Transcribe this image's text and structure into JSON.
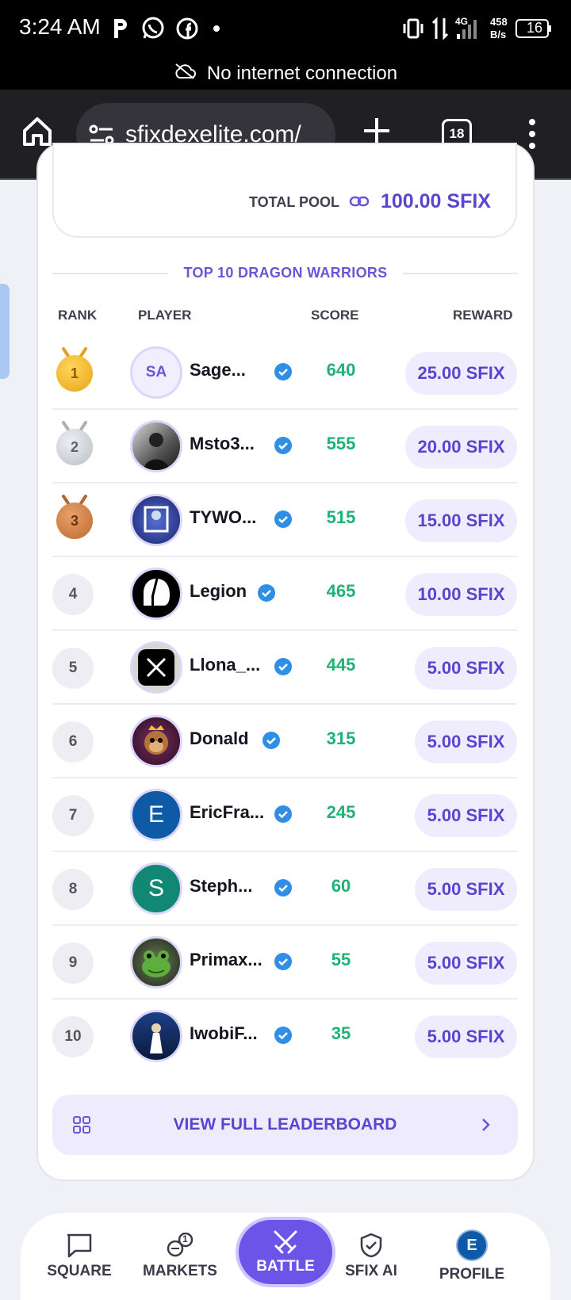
{
  "status_bar": {
    "time": "3:24 AM",
    "network_type": "4G",
    "data_speed_value": "458",
    "data_speed_unit": "B/s",
    "battery": "16",
    "notice": "No internet connection"
  },
  "browser": {
    "url": "sfixdexelite.com/",
    "tab_count": "18"
  },
  "pool": {
    "label": "TOTAL POOL",
    "value": "100.00 SFIX"
  },
  "leaderboard": {
    "title": "TOP 10 DRAGON WARRIORS",
    "headers": {
      "rank": "RANK",
      "player": "PLAYER",
      "score": "SCORE",
      "reward": "REWARD"
    },
    "rows": [
      {
        "rank": "1",
        "name": "Sage...",
        "initials": "SA",
        "score": "640",
        "reward": "25.00 SFIX"
      },
      {
        "rank": "2",
        "name": "Msto3...",
        "score": "555",
        "reward": "20.00 SFIX"
      },
      {
        "rank": "3",
        "name": "TYWO...",
        "score": "515",
        "reward": "15.00 SFIX"
      },
      {
        "rank": "4",
        "name": "Legion",
        "score": "465",
        "reward": "10.00 SFIX"
      },
      {
        "rank": "5",
        "name": "Llona_...",
        "score": "445",
        "reward": "5.00 SFIX"
      },
      {
        "rank": "6",
        "name": "Donald",
        "score": "315",
        "reward": "5.00 SFIX"
      },
      {
        "rank": "7",
        "name": "EricFra...",
        "initials": "E",
        "score": "245",
        "reward": "5.00 SFIX"
      },
      {
        "rank": "8",
        "name": "Steph...",
        "initials": "S",
        "score": "60",
        "reward": "5.00 SFIX"
      },
      {
        "rank": "9",
        "name": "Primax...",
        "score": "55",
        "reward": "5.00 SFIX"
      },
      {
        "rank": "10",
        "name": "IwobiF...",
        "score": "35",
        "reward": "5.00 SFIX"
      }
    ],
    "view_full": "VIEW FULL LEADERBOARD"
  },
  "bottom_nav": {
    "square": "SQUARE",
    "markets": "MARKETS",
    "markets_badge": "1",
    "battle": "BATTLE",
    "sfix_ai": "SFIX AI",
    "profile": "PROFILE",
    "profile_initial": "E"
  },
  "colors": {
    "accent": "#6c54e8",
    "score_green": "#1fb276",
    "verified_blue": "#2f8fe6",
    "gold": "#f0b323",
    "silver": "#c9ced6",
    "bronze": "#c9783c"
  }
}
